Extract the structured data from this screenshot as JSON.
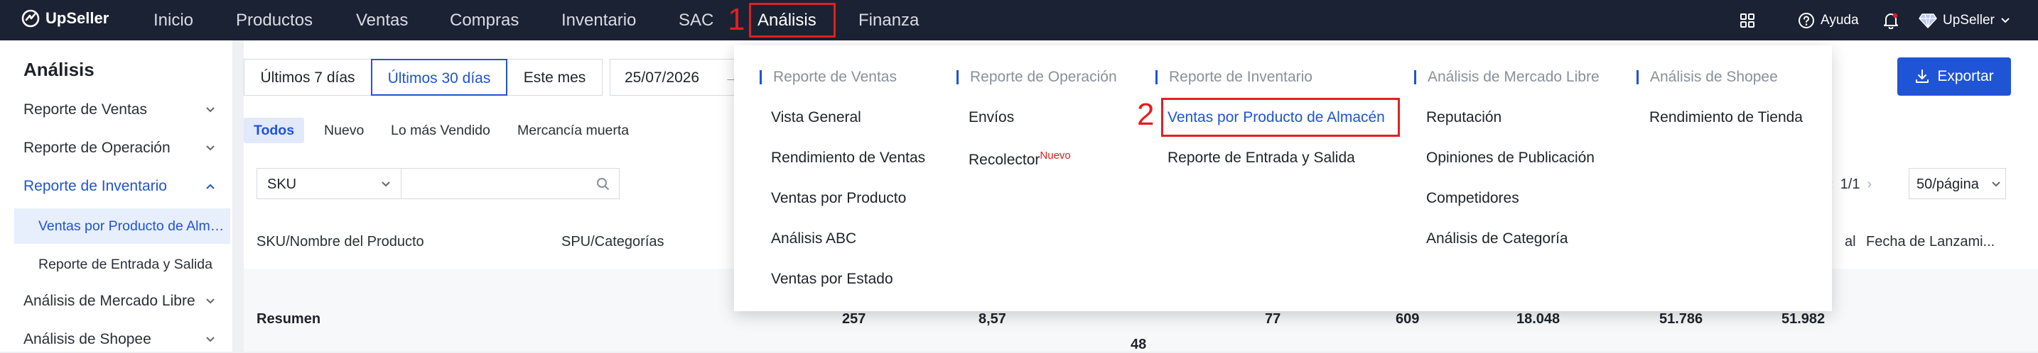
{
  "app": {
    "name": "UpSeller"
  },
  "topnav": {
    "items": [
      "Inicio",
      "Productos",
      "Ventas",
      "Compras",
      "Inventario",
      "SAC",
      "Análisis",
      "Finanza"
    ],
    "help": "Ayuda",
    "user": "UpSeller"
  },
  "annotations": {
    "step1": "1",
    "step2": "2"
  },
  "sidebar": {
    "title": "Análisis",
    "items": [
      "Reporte de Ventas",
      "Reporte de Operación",
      "Reporte de Inventario",
      "Análisis de Mercado Libre",
      "Análisis de Shopee"
    ],
    "subitems": [
      "Ventas por Producto de Almacén",
      "Reporte de Entrada y Salida"
    ]
  },
  "filters": {
    "ranges": [
      "Últimos 7 días",
      "Últimos 30 días",
      "Este mes"
    ],
    "selected_range": "Últimos 30 días",
    "date_start": "25/07/2026",
    "chips": [
      "Todos",
      "Nuevo",
      "Lo más Vendido",
      "Mercancía muerta"
    ],
    "search_field": "SKU"
  },
  "toolbar": {
    "export_label": "Exportar"
  },
  "pagination": {
    "page": "1/1",
    "page_size": "50/página"
  },
  "table": {
    "headers": {
      "sku": "SKU/Nombre del Producto",
      "spu": "SPU/Categorías",
      "total_suffix": "al",
      "launch": "Fecha de Lanzami..."
    },
    "summary": {
      "label": "Resumen",
      "values": [
        "257",
        "8,57",
        "48",
        "77",
        "609",
        "18.048",
        "51.786",
        "51.982"
      ]
    }
  },
  "dropdown": {
    "columns": [
      {
        "title": "Reporte de Ventas",
        "links": [
          "Vista General",
          "Rendimiento de Ventas",
          "Ventas por Producto",
          "Análisis ABC",
          "Ventas por Estado"
        ]
      },
      {
        "title": "Reporte de Operación",
        "links": [
          "Envíos",
          "Recolector"
        ],
        "badge": "Nuevo"
      },
      {
        "title": "Reporte de Inventario",
        "links": [
          "Ventas por Producto de Almacén",
          "Reporte de Entrada y Salida"
        ]
      },
      {
        "title": "Análisis de Mercado Libre",
        "links": [
          "Reputación",
          "Opiniones de Publicación",
          "Competidores",
          "Análisis de Categoría"
        ]
      },
      {
        "title": "Análisis de Shopee",
        "links": [
          "Rendimiento de Tienda"
        ]
      }
    ]
  },
  "colors": {
    "topbar": "#1a2233",
    "accent": "#1f54d6",
    "annotation": "#e02020"
  }
}
